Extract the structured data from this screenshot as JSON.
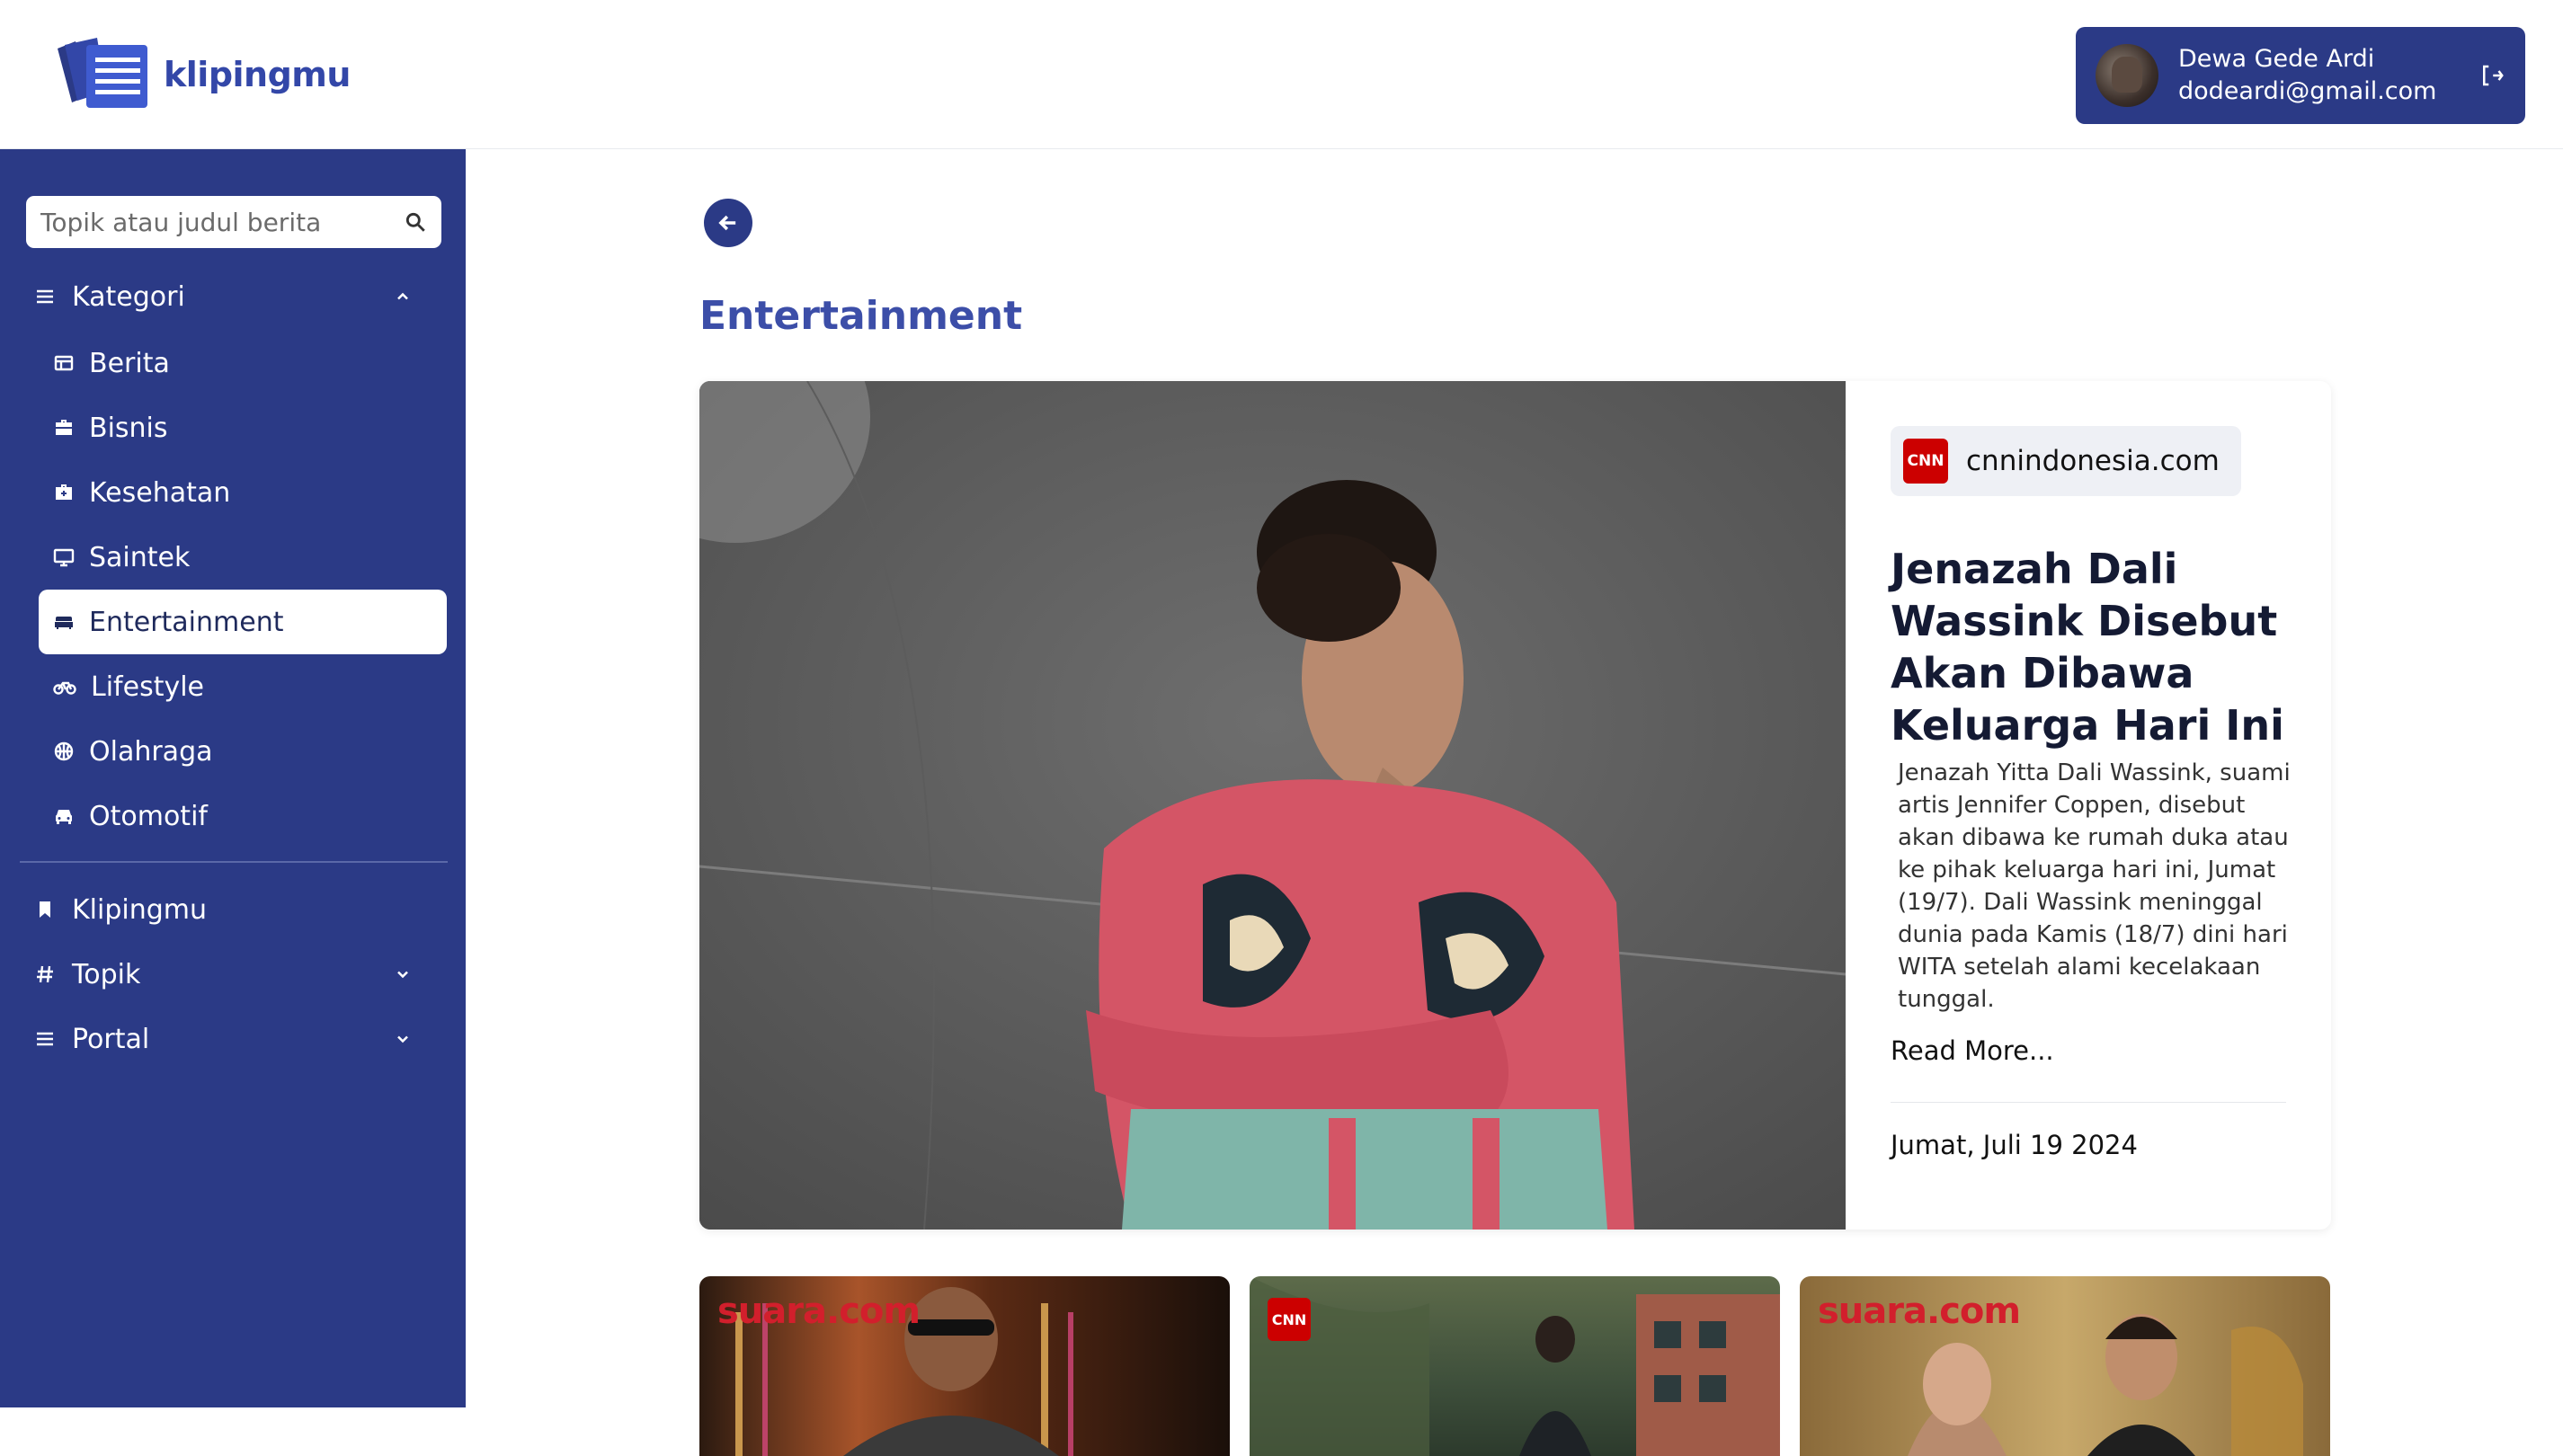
{
  "app": {
    "name": "klipingmu"
  },
  "user": {
    "name": "Dewa Gede Ardi",
    "email": "dodeardi@gmail.com"
  },
  "search": {
    "placeholder": "Topik atau judul berita"
  },
  "sidebar": {
    "kategori_label": "Kategori",
    "items": [
      {
        "label": "Berita",
        "icon": "newspaper-icon"
      },
      {
        "label": "Bisnis",
        "icon": "briefcase-icon"
      },
      {
        "label": "Kesehatan",
        "icon": "medkit-icon"
      },
      {
        "label": "Saintek",
        "icon": "monitor-icon"
      },
      {
        "label": "Entertainment",
        "icon": "couch-icon",
        "active": true
      },
      {
        "label": "Lifestyle",
        "icon": "bicycle-icon"
      },
      {
        "label": "Olahraga",
        "icon": "basketball-icon"
      },
      {
        "label": "Otomotif",
        "icon": "car-icon"
      }
    ],
    "klipingmu_label": "Klipingmu",
    "topik_label": "Topik",
    "portal_label": "Portal"
  },
  "page": {
    "title": "Entertainment"
  },
  "hero": {
    "source": "cnnindonesia.com",
    "source_logo": "CNN",
    "title": "Jenazah Dali Wassink Disebut Akan Dibawa Keluarga Hari Ini",
    "description": "Jenazah Yitta Dali Wassink, suami artis Jennifer Coppen, disebut akan dibawa ke rumah duka atau ke pihak keluarga hari ini, Jumat (19/7). Dali Wassink meninggal dunia pada Kamis (18/7) dini hari WITA setelah alami kecelakaan tunggal.",
    "read_more": "Read More...",
    "date": "Jumat, Juli 19 2024"
  },
  "cards": [
    {
      "source": "suara.com"
    },
    {
      "source": "CNN"
    },
    {
      "source": "suara.com"
    }
  ],
  "colors": {
    "primary": "#2b3a86",
    "accent": "#3c4ea8",
    "brand_red": "#cc0000"
  }
}
